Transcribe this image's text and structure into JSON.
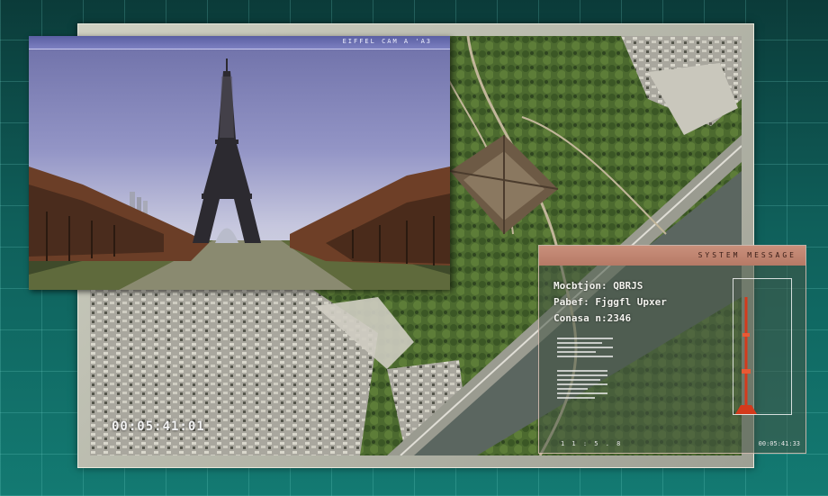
{
  "photo_window": {
    "title": "EIFFEL CAM A 'A3"
  },
  "map_window": {
    "timecode": "00:05:41:01"
  },
  "system_message": {
    "title": "SYSTEM MESSAGE",
    "lines": [
      "Mocbtjon: QBRJS",
      "Pabef: Fjggfl Upxer",
      "Conasa n:2346"
    ],
    "small_code": "1 1 : 5 . 8",
    "small_timecode": "00:05:41:33"
  }
}
